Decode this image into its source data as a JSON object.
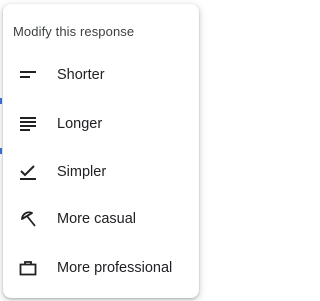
{
  "menu": {
    "title": "Modify this response",
    "items": [
      {
        "label": "Shorter",
        "icon": "short-text-icon"
      },
      {
        "label": "Longer",
        "icon": "long-text-icon"
      },
      {
        "label": "Simpler",
        "icon": "check-underline-icon"
      },
      {
        "label": "More casual",
        "icon": "beach-umbrella-icon"
      },
      {
        "label": "More professional",
        "icon": "briefcase-icon"
      }
    ]
  },
  "colors": {
    "text": "#202124",
    "title": "#3c4043",
    "icon": "#202124"
  }
}
